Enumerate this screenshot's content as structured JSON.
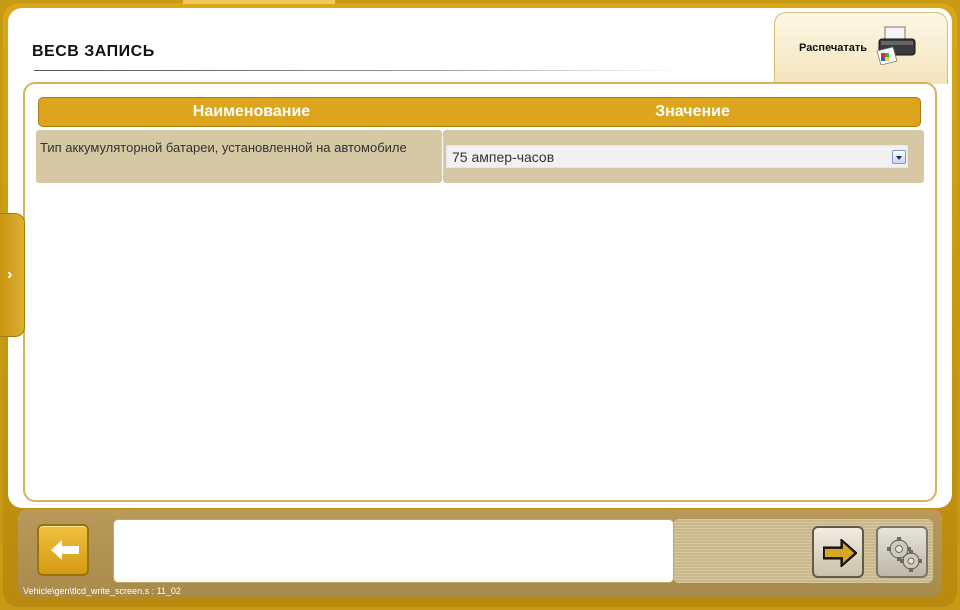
{
  "header": {
    "title": "ВЕСВ ЗАПИСЬ",
    "print_label": "Распечатать"
  },
  "table": {
    "columns": [
      "Наименование",
      "Значение"
    ],
    "rows": [
      {
        "name": "Тип аккумуляторной батареи, установленной на автомобиле",
        "value": "75 ампер-часов"
      }
    ]
  },
  "footer": {
    "path": "Vehicle\\gen\\tlcd_write_screen.s : 11_02",
    "message": ""
  },
  "icons": {
    "print": "printer-icon",
    "back": "arrow-left-icon",
    "next": "arrow-right-icon",
    "settings": "gears-icon",
    "side": "chevron-right-icon",
    "dropdown": "chevron-down-icon"
  },
  "colors": {
    "frame": "#c79a16",
    "header_bar": "#dca51d",
    "row_bg": "#d6c7a5"
  }
}
